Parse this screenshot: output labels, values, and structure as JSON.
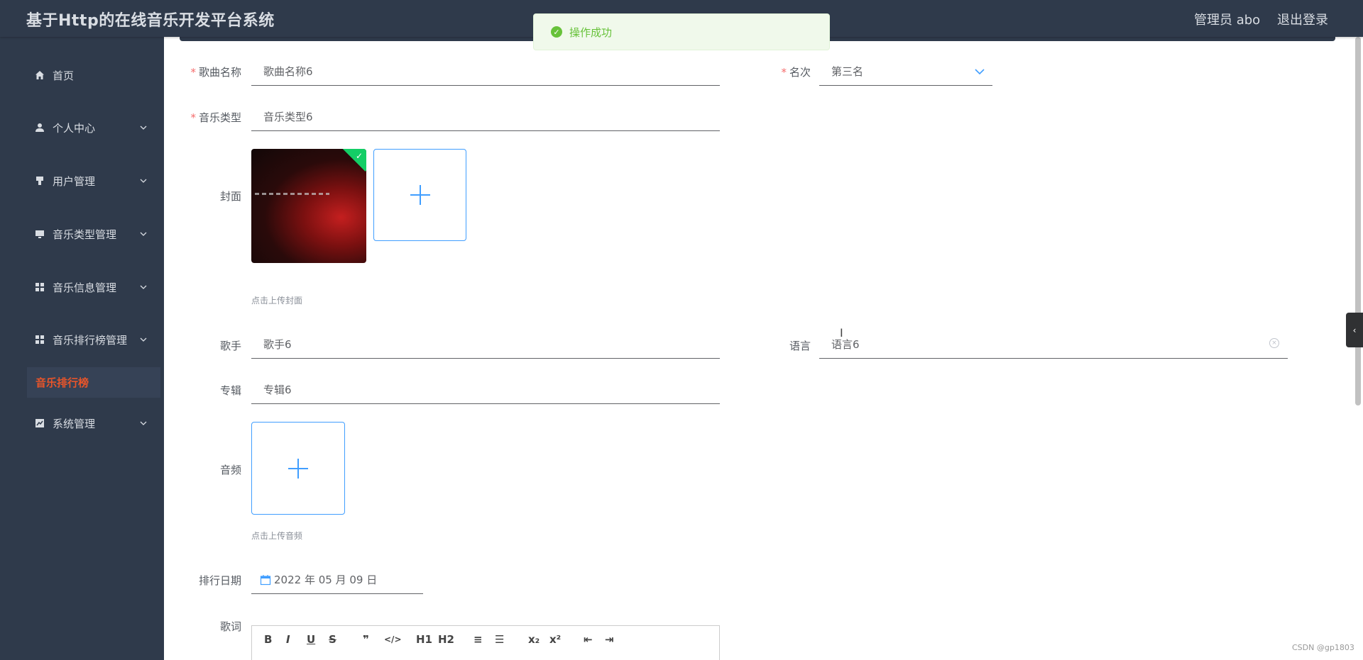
{
  "header": {
    "title": "基于Http的在线音乐开发平台系统",
    "admin": "管理员 abo",
    "logout": "退出登录"
  },
  "sidebar": {
    "items": [
      {
        "label": "首页",
        "icon": "home-icon"
      },
      {
        "label": "个人中心",
        "icon": "user-icon"
      },
      {
        "label": "用户管理",
        "icon": "users-icon"
      },
      {
        "label": "音乐类型管理",
        "icon": "monitor-icon"
      },
      {
        "label": "音乐信息管理",
        "icon": "grid-icon"
      },
      {
        "label": "音乐排行榜管理",
        "icon": "grid-icon"
      },
      {
        "label": "系统管理",
        "icon": "chart-icon"
      }
    ],
    "active_sub": "音乐排行榜"
  },
  "toast": {
    "text": "操作成功"
  },
  "form": {
    "song_name": {
      "label": "歌曲名称",
      "value": "歌曲名称6"
    },
    "rank": {
      "label": "名次",
      "value": "第三名"
    },
    "music_type": {
      "label": "音乐类型",
      "value": "音乐类型6"
    },
    "cover": {
      "label": "封面",
      "hint": "点击上传封面"
    },
    "singer": {
      "label": "歌手",
      "value": "歌手6"
    },
    "language": {
      "label": "语言",
      "value": "语言6"
    },
    "album": {
      "label": "专辑",
      "value": "专辑6"
    },
    "audio": {
      "label": "音频",
      "hint": "点击上传音频"
    },
    "rank_date": {
      "label": "排行日期",
      "value": "2022 年 05 月 09 日"
    },
    "lyrics": {
      "label": "歌词"
    }
  },
  "editor_toolbar": [
    "B",
    "I",
    "U",
    "S",
    "❞",
    "</>",
    "H1",
    "H2",
    "≡",
    "☰",
    "x₂",
    "x²",
    "⇤",
    "⇥"
  ],
  "watermark": "CSDN @gp1803"
}
